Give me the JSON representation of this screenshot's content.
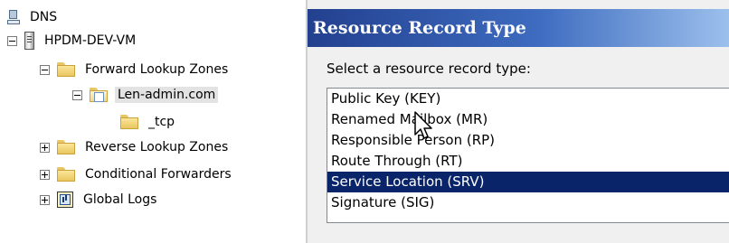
{
  "tree": {
    "root_label": "DNS",
    "server_label": "HPDM-DEV-VM",
    "forward_zones_label": "Forward Lookup Zones",
    "zone_label": "Len-admin.com",
    "subfolder_label": "_tcp",
    "reverse_zones_label": "Reverse Lookup Zones",
    "conditional_forwarders_label": "Conditional Forwarders",
    "global_logs_label": "Global Logs"
  },
  "dialog": {
    "title": "Resource Record Type",
    "prompt": "Select a resource record type:",
    "options": [
      "Public Key (KEY)",
      "Renamed Mailbox (MR)",
      "Responsible Person (RP)",
      "Route Through (RT)",
      "Service Location (SRV)",
      "Signature (SIG)"
    ],
    "selected_option": "Service Location (SRV)"
  },
  "colors": {
    "selection": "#0a246a",
    "title_gradient_start": "#23408f",
    "title_gradient_end": "#9cc0ec"
  }
}
